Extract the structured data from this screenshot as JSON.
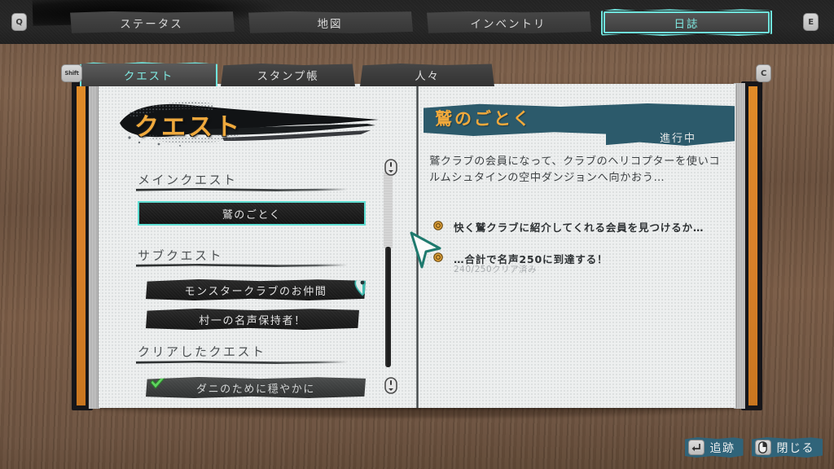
{
  "keys": {
    "left_main": "Q",
    "right_main": "E",
    "left_sub": "Shift",
    "right_sub": "C"
  },
  "main_tabs": [
    {
      "label": "ステータス",
      "active": false,
      "name": "tab-status"
    },
    {
      "label": "地図",
      "active": false,
      "name": "tab-map"
    },
    {
      "label": "インベントリ",
      "active": false,
      "name": "tab-inventory"
    },
    {
      "label": "日誌",
      "active": true,
      "name": "tab-journal"
    }
  ],
  "sub_tabs": [
    {
      "label": "クエスト",
      "active": true,
      "name": "subtab-quests"
    },
    {
      "label": "スタンプ帳",
      "active": false,
      "name": "subtab-stampbook"
    },
    {
      "label": "人々",
      "active": false,
      "name": "subtab-people"
    }
  ],
  "left_page": {
    "title": "クエスト",
    "sections": [
      {
        "heading": "メインクエスト",
        "quests": [
          {
            "label": "鷲のごとく",
            "selected": true,
            "pin": false,
            "completed": false
          }
        ]
      },
      {
        "heading": "サブクエスト",
        "quests": [
          {
            "label": "モンスタークラブのお仲間",
            "selected": false,
            "pin": true,
            "completed": false
          },
          {
            "label": "村一の名声保持者！",
            "selected": false,
            "pin": false,
            "completed": false
          }
        ]
      },
      {
        "heading": "クリアしたクエスト",
        "quests": [
          {
            "label": "ダニのために穏やかに",
            "selected": false,
            "pin": false,
            "completed": true
          }
        ]
      }
    ]
  },
  "right_page": {
    "quest_title": "鷲のごとく",
    "status": "進行中",
    "description": "鷲クラブの会員になって、クラブのヘリコプターを使いコルムシュタインの空中ダンジョンへ向かおう…",
    "objectives": [
      {
        "text": "快く鷲クラブに紹介してくれる会員を見つけるか…",
        "progress": ""
      },
      {
        "text": "…合計で名声250に到達する！",
        "progress": "240/250クリア済み"
      }
    ]
  },
  "bottom_hints": [
    {
      "label": "追跡",
      "key_icon": "enter-key-icon",
      "name": "track-button"
    },
    {
      "label": "閉じる",
      "key_icon": "mouse-right-click-icon",
      "name": "close-button"
    }
  ],
  "colors": {
    "accent_cyan": "#6fe3dc",
    "accent_gold": "#f0a93c",
    "banner_teal": "#2c5a6b",
    "book_spine_orange": "#d9812a",
    "wood_bg": "#6f5542"
  }
}
